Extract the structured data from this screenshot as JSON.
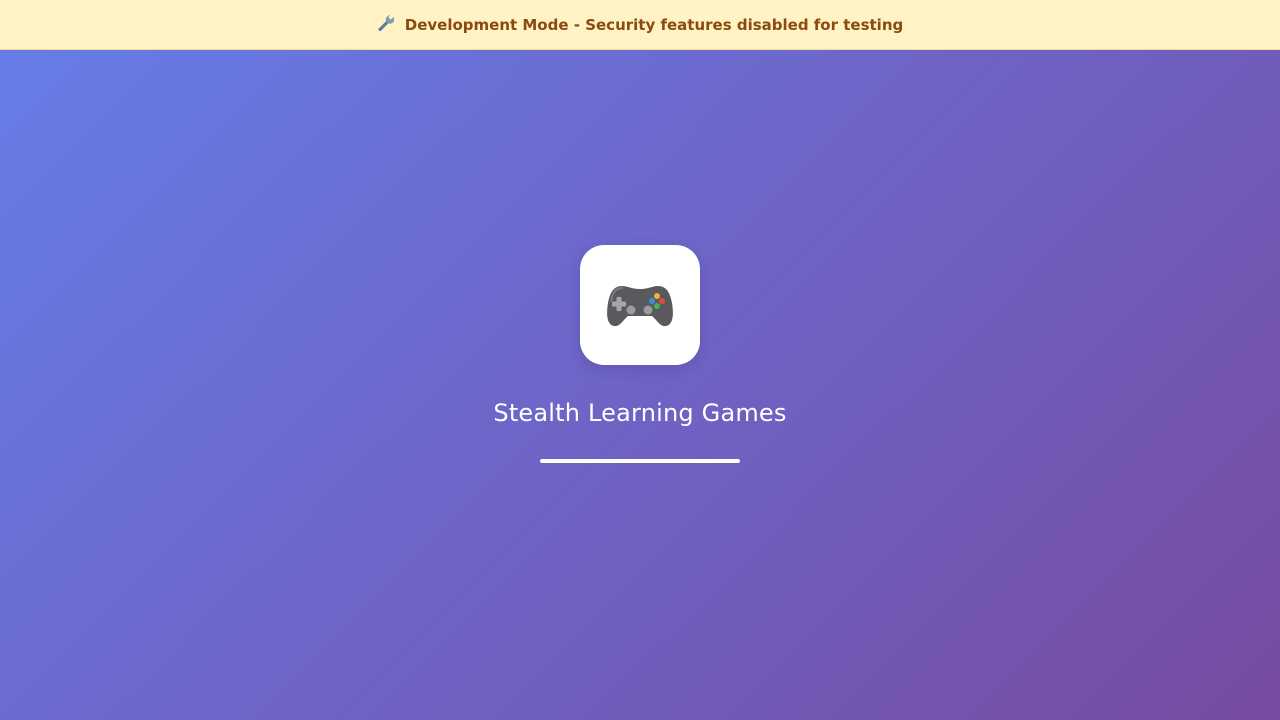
{
  "banner": {
    "icon": "wrench-icon",
    "text": "Development Mode - Security features disabled for testing"
  },
  "splash": {
    "logo_icon": "game-controller-icon",
    "title": "Stealth Learning Games",
    "progress": 1.0
  },
  "colors": {
    "background_start": "#667eea",
    "background_end": "#764ba2",
    "banner_background": "#fff3c4",
    "banner_text": "#8a4a10"
  }
}
